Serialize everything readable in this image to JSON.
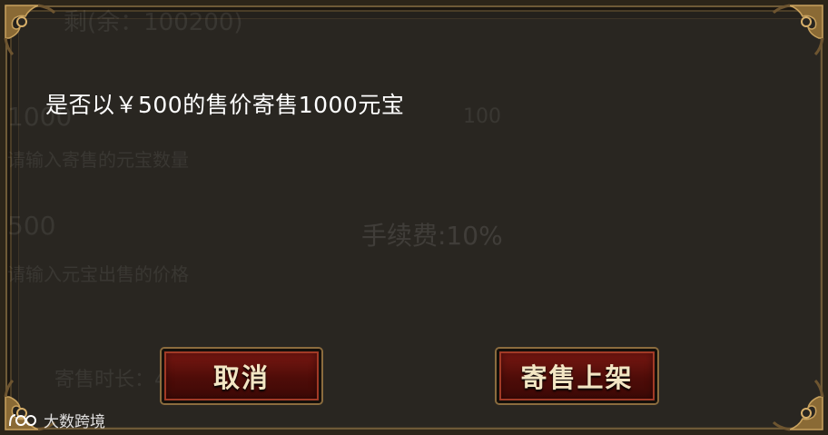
{
  "dialog": {
    "message": "是否以￥500的售价寄售1000元宝",
    "cancel_label": "取消",
    "confirm_label": "寄售上架"
  },
  "background_text": {
    "line1": "剩(余：100200)",
    "line2": "1000",
    "line3": "100",
    "line4": "请输入寄售的元宝数量",
    "line5": "500",
    "line6": "手续费:10%",
    "line7": "请输入元宝出售的价格",
    "line8": "寄售时长：48小时后自动下架"
  },
  "watermark": {
    "text": "大数跨境"
  },
  "colors": {
    "button_red": "#5a0f0a",
    "frame_gold": "#8b6c3e",
    "panel_bg": "#292621"
  }
}
